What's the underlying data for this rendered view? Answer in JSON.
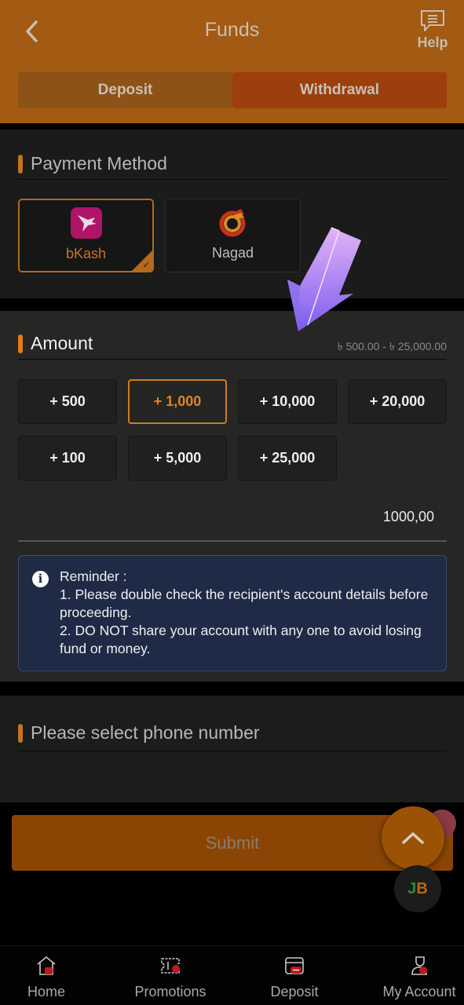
{
  "header": {
    "title": "Funds",
    "back_icon": "chevron-left-icon",
    "help_label": "Help",
    "help_icon": "chat-bubble-icon",
    "tabs": [
      {
        "label": "Deposit",
        "active": false
      },
      {
        "label": "Withdrawal",
        "active": true
      }
    ]
  },
  "payment_method": {
    "title": "Payment Method",
    "methods": [
      {
        "label": "bKash",
        "icon": "bkash-bird-logo",
        "selected": true
      },
      {
        "label": "Nagad",
        "icon": "nagad-logo",
        "selected": false
      }
    ]
  },
  "amount": {
    "title": "Amount",
    "range": "৳ 500.00 - ৳ 25,000.00",
    "quick_buttons": [
      {
        "label": "+ 500",
        "selected": false
      },
      {
        "label": "+ 1,000",
        "selected": true
      },
      {
        "label": "+ 10,000",
        "selected": false
      },
      {
        "label": "+ 20,000",
        "selected": false
      },
      {
        "label": "+ 100",
        "selected": false
      },
      {
        "label": "+ 5,000",
        "selected": false
      },
      {
        "label": "+ 25,000",
        "selected": false
      }
    ],
    "value": "1000,00"
  },
  "reminder": {
    "icon": "info-icon",
    "title": "Reminder :",
    "lines": [
      "1. Please double check the recipient's account details before proceeding.",
      "2. DO NOT share your account with any one to avoid losing fund or money."
    ]
  },
  "phone": {
    "title": "Please select phone number"
  },
  "submit_label": "Submit",
  "floating": {
    "scroll_top_icon": "chevron-up-icon",
    "brand_badge": "JB"
  },
  "bottom_nav": [
    {
      "label": "Home",
      "icon": "home-icon"
    },
    {
      "label": "Promotions",
      "icon": "ticket-icon"
    },
    {
      "label": "Deposit",
      "icon": "wallet-icon"
    },
    {
      "label": "My Account",
      "icon": "user-icon"
    }
  ],
  "colors": {
    "header": "#a35a13",
    "accent": "#e07b1a",
    "active_tab": "#9c3f0c",
    "reminder_bg": "#1f2a47",
    "overlay_arrow": "#b48cf0"
  }
}
